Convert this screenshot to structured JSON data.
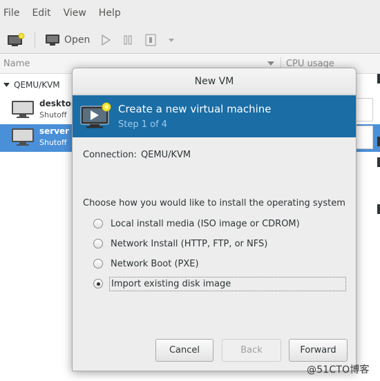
{
  "menubar": {
    "items": [
      "File",
      "Edit",
      "View",
      "Help"
    ]
  },
  "toolbar": {
    "open_label": "Open"
  },
  "vm_list": {
    "column_name": "Name",
    "column_cpu": "CPU usage",
    "connection": "QEMU/KVM",
    "vms": [
      {
        "name": "desktop",
        "state": "Shutoff",
        "selected": false
      },
      {
        "name": "server",
        "state": "Shutoff",
        "selected": true
      }
    ]
  },
  "dialog": {
    "title": "New VM",
    "banner_title": "Create a new virtual machine",
    "banner_step": "Step 1 of 4",
    "connection_label": "Connection:",
    "connection_value": "QEMU/KVM",
    "question": "Choose how you would like to install the operating system",
    "options": [
      {
        "label": "Local install media (ISO image or CDROM)",
        "checked": false
      },
      {
        "label": "Network Install (HTTP, FTP, or NFS)",
        "checked": false
      },
      {
        "label": "Network Boot (PXE)",
        "checked": false
      },
      {
        "label": "Import existing disk image",
        "checked": true
      }
    ],
    "buttons": {
      "cancel": "Cancel",
      "back": "Back",
      "forward": "Forward"
    }
  },
  "watermark": "@51CTO博客",
  "colors": {
    "banner": "#1a6da5",
    "selection": "#4a90d9"
  }
}
